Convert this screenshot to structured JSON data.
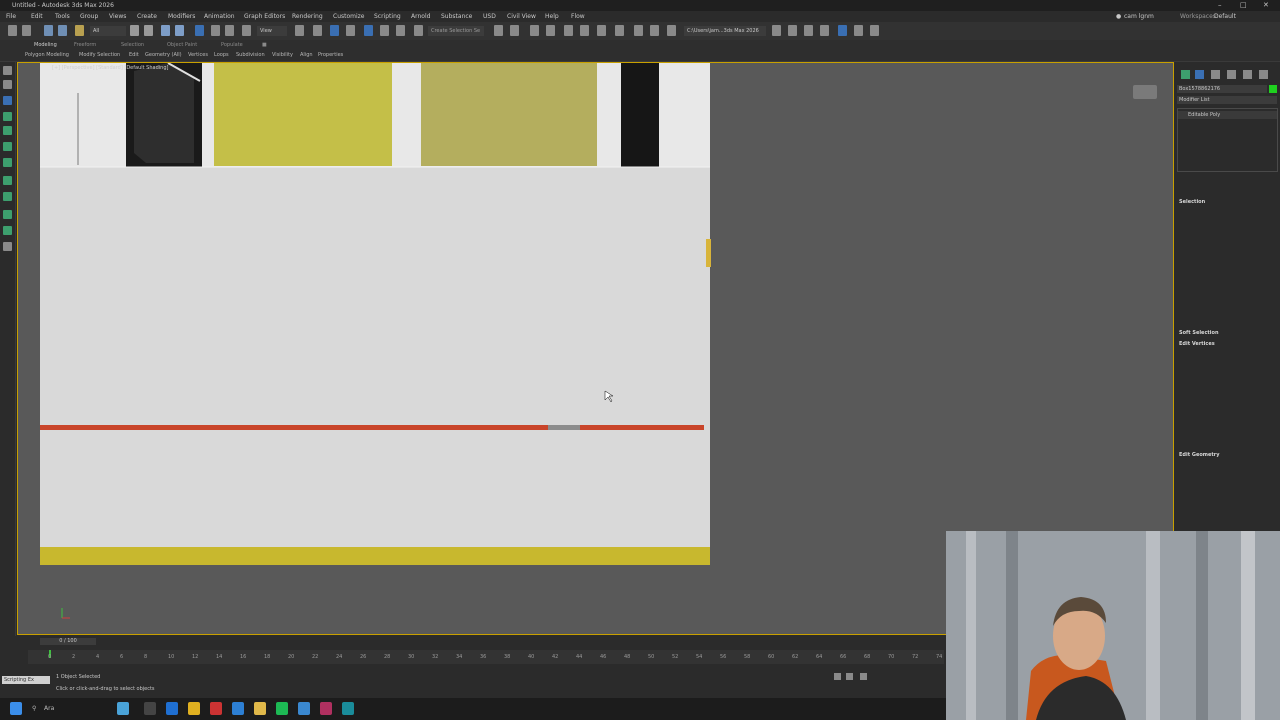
{
  "window": {
    "title": "Untitled - Autodesk 3ds Max 2026"
  },
  "menubar": {
    "items": [
      "File",
      "Edit",
      "Tools",
      "Group",
      "Views",
      "Create",
      "Modifiers",
      "Animation",
      "Graph Editors",
      "Rendering",
      "Customize",
      "Scripting",
      "Arnold",
      "Substance",
      "USD",
      "Civil View",
      "Help",
      "Flow"
    ],
    "user": "cam lgnm",
    "workspaces_label": "Workspaces:",
    "workspace": "Default"
  },
  "toolbar": {
    "selection_filter": "All",
    "view_dropdown": "View",
    "selection_set_placeholder": "Create Selection Se",
    "project_path": "C:\\Users\\jam...3ds Max 2026"
  },
  "ribbon": {
    "tabs": [
      "Modeling",
      "Freeform",
      "Selection",
      "Object Paint",
      "Populate"
    ],
    "subtabs": [
      "Polygon Modeling",
      "Modify Selection",
      "Edit",
      "Geometry (All)",
      "Vertices",
      "Loops",
      "Subdivision",
      "Visibility",
      "Align",
      "Properties"
    ]
  },
  "viewport": {
    "label": "[+] [Perspective] [Standard] [Default Shading]"
  },
  "command_panel": {
    "object_name": "Box1578862176",
    "modifier_list": "Modifier List",
    "stack_item": "Editable Poly",
    "rollouts": [
      "Selection",
      "Soft Selection",
      "Edit Vertices",
      "Edit Geometry"
    ],
    "object_color": "#1fd11f"
  },
  "timeline": {
    "frame_display": "0 / 100",
    "ticks": [
      "0",
      "2",
      "4",
      "6",
      "8",
      "10",
      "12",
      "14",
      "16",
      "18",
      "20",
      "22",
      "24",
      "26",
      "28",
      "30",
      "32",
      "34",
      "36",
      "38",
      "40",
      "42",
      "44",
      "46",
      "48",
      "50",
      "52",
      "54",
      "56",
      "58",
      "60",
      "62",
      "64",
      "66",
      "68",
      "70",
      "72",
      "74"
    ]
  },
  "status": {
    "selected": "1 Object Selected",
    "prompt": "Click or click-and-drag to select objects",
    "script_label": "Scripting Ex"
  },
  "taskbar": {
    "search_placeholder": "Ara"
  },
  "colors": {
    "viewport_border": "#c8a000",
    "accent_blue": "#3a6fb3",
    "red_stripe": "#c9452a",
    "yellow": "#c8b82e"
  }
}
